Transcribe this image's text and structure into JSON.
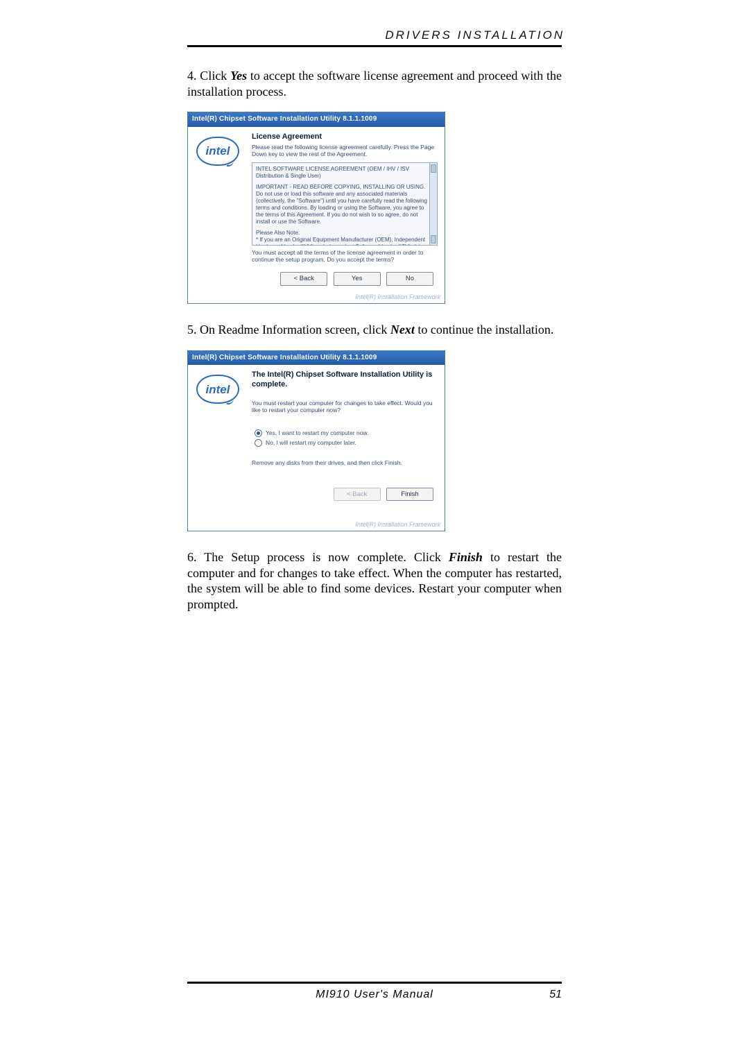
{
  "header": {
    "section_title": "DRIVERS INSTALLATION"
  },
  "step4": {
    "prefix": "4. Click ",
    "keyword": "Yes",
    "suffix": " to accept the software license agreement and proceed with the installation process."
  },
  "dialog1": {
    "title": "Intel(R) Chipset Software Installation Utility 8.1.1.1009",
    "logo_text": "intel",
    "heading": "License Agreement",
    "lead": "Please read the following license agreement carefully. Press the Page Down key to view the rest of the Agreement.",
    "eula_p1": "INTEL SOFTWARE LICENSE AGREEMENT (OEM / IHV / ISV Distribution & Single User)",
    "eula_p2": "IMPORTANT - READ BEFORE COPYING, INSTALLING OR USING. Do not use or load this software and any associated materials (collectively, the \"Software\") until you have carefully read the following terms and conditions. By loading or using the Software, you agree to the terms of this Agreement. If you do not wish to so agree, do not install or use the Software.",
    "eula_p3": "Please Also Note:",
    "eula_p4": "* If you are an Original Equipment Manufacturer (OEM), Independent Hardware Vendor (IHV), or Independent Software Vendor (ISV), this complete LICENSE AGREEMENT applies;",
    "after_box": "You must accept all the terms of the license agreement in order to continue the setup program. Do you accept the terms?",
    "buttons": {
      "back": "< Back",
      "yes": "Yes",
      "no": "No"
    },
    "brand_footer": "Intel(R) Installation Framework"
  },
  "step5": {
    "prefix": "5. On Readme Information screen, click ",
    "keyword": "Next",
    "suffix": " to continue the installation."
  },
  "dialog2": {
    "title": "Intel(R) Chipset Software Installation Utility 8.1.1.1009",
    "logo_text": "intel",
    "heading": "The Intel(R) Chipset Software Installation Utility is complete.",
    "lead": "You must restart your computer for changes to take effect. Would you like to restart your computer now?",
    "radio_yes": "Yes, I want to restart my computer now.",
    "radio_no": "No, I will restart my computer later.",
    "remove_note": "Remove any disks from their drives, and then click Finish.",
    "buttons": {
      "back": "< Back",
      "finish": "Finish"
    },
    "brand_footer": "Intel(R) Installation Framework"
  },
  "step6": {
    "prefix": "6. The Setup process is now complete.  Click ",
    "keyword": "Finish",
    "suffix": " to restart the computer and for changes to take effect. When the computer has restarted, the system will be able to find some devices. Restart your computer when prompted."
  },
  "page_footer": {
    "manual": "MI910 User's Manual",
    "page_no": "51"
  }
}
